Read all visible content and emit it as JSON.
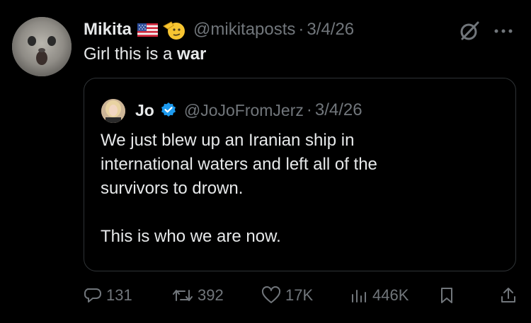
{
  "tweet": {
    "author": {
      "name": "Mikita",
      "handle": "@mikitaposts",
      "date": "3/4/26",
      "avatar_icon": "avatar-photo",
      "badges": [
        "us-flag-emoji",
        "saluting-face-emoji"
      ]
    },
    "text": {
      "prefix": "Girl this is a ",
      "bold": "war"
    },
    "header_icons": [
      "grok-icon",
      "more-icon"
    ],
    "quote": {
      "author": {
        "name": "Jo",
        "handle": "@JoJoFromJerz",
        "date": "3/4/26",
        "verified": true,
        "avatar_icon": "avatar-photo"
      },
      "lines": [
        "We just blew up an Iranian ship in",
        "international waters and left all of the",
        "survivors to drown."
      ],
      "closing": "This is who we are now."
    },
    "actions": {
      "replies": "131",
      "reposts": "392",
      "likes": "17K",
      "views": "446K"
    },
    "separator": "·",
    "colors": {
      "background": "#000000",
      "text": "#e7e9ea",
      "muted": "#71767b",
      "border": "#2f3336",
      "verified": "#1d9bf0"
    }
  }
}
